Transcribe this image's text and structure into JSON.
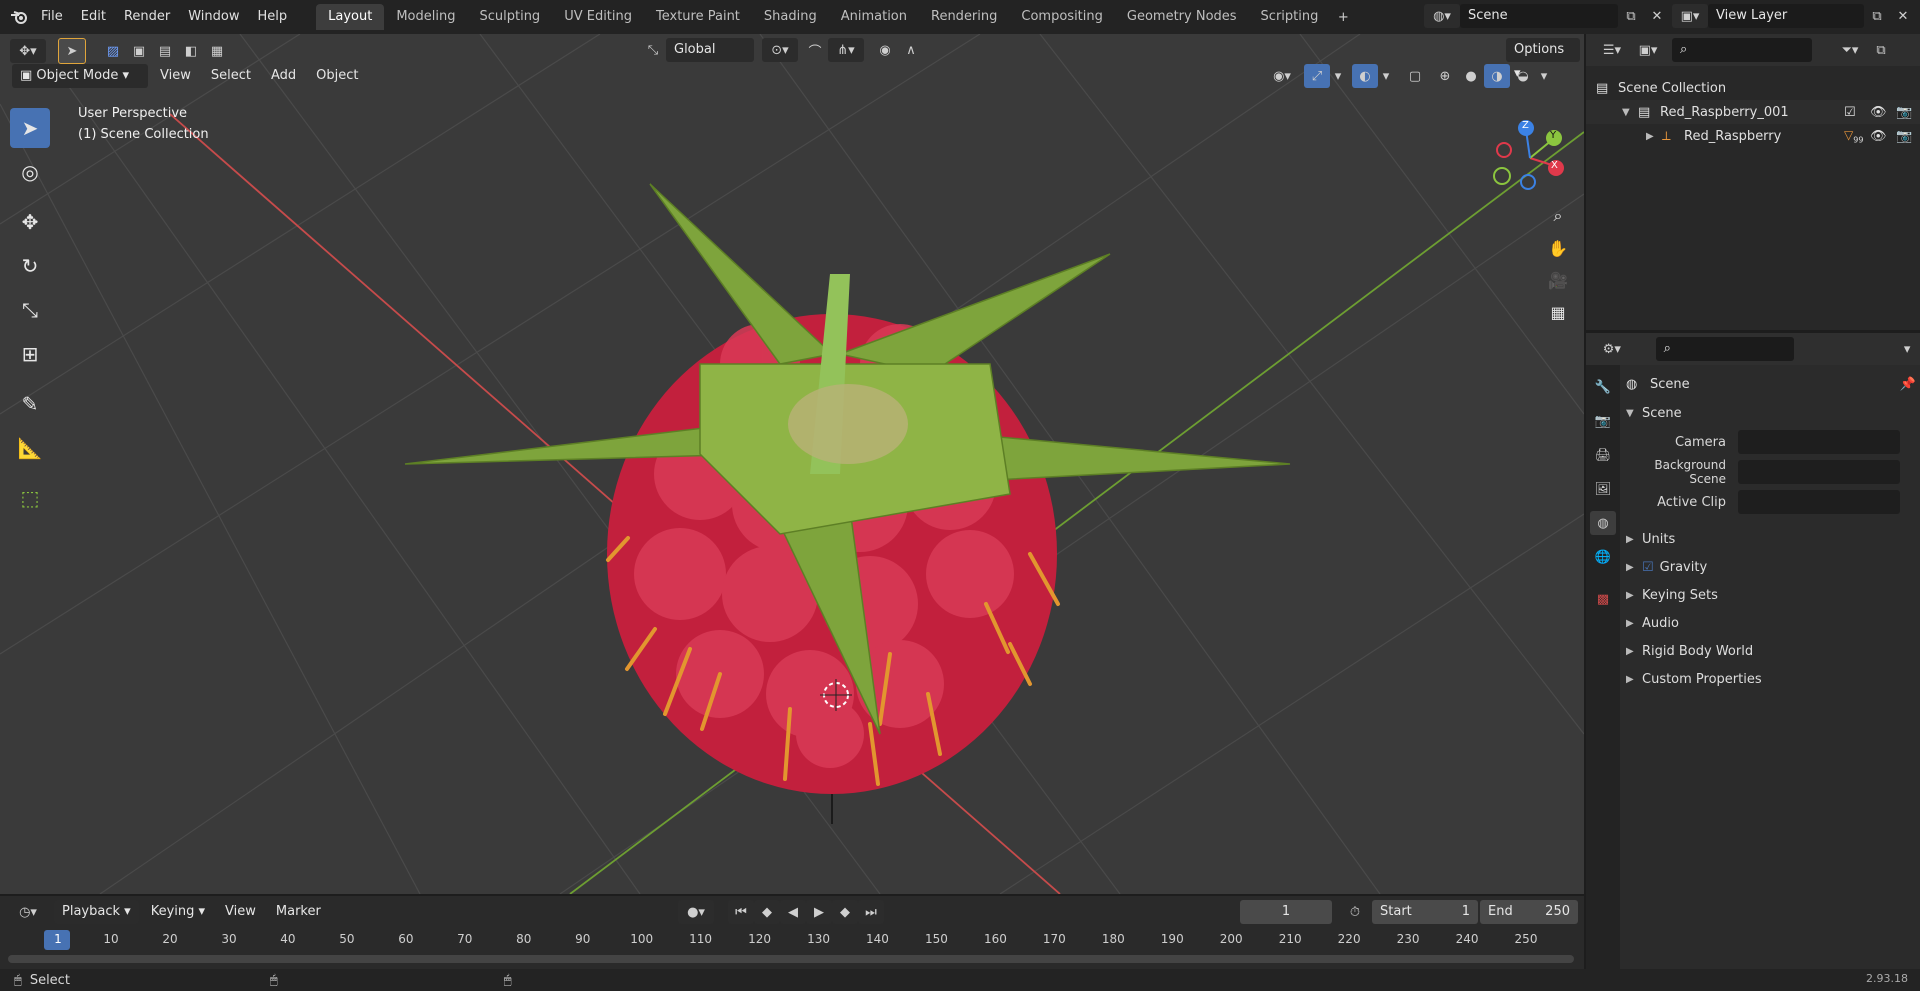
{
  "menu": {
    "file": "File",
    "edit": "Edit",
    "render": "Render",
    "window": "Window",
    "help": "Help"
  },
  "workspaces": [
    "Layout",
    "Modeling",
    "Sculpting",
    "UV Editing",
    "Texture Paint",
    "Shading",
    "Animation",
    "Rendering",
    "Compositing",
    "Geometry Nodes",
    "Scripting"
  ],
  "top_right": {
    "scene": "Scene",
    "view_layer": "View Layer"
  },
  "viewport": {
    "transform_orientation": "Global",
    "options": "Options",
    "mode": "Object Mode",
    "menus": [
      "View",
      "Select",
      "Add",
      "Object"
    ],
    "overlay_line1": "User Perspective",
    "overlay_line2": "(1) Scene Collection",
    "gizmo": {
      "x": "X",
      "y": "Y",
      "z": "Z"
    }
  },
  "outliner": {
    "root": "Scene Collection",
    "collection": "Red_Raspberry_001",
    "object": "Red_Raspberry",
    "badge": "99"
  },
  "properties": {
    "header": "Scene",
    "panel": "Scene",
    "camera_label": "Camera",
    "bg_scene_label": "Background Scene",
    "active_clip_label": "Active Clip",
    "sections": [
      "Units",
      "Gravity",
      "Keying Sets",
      "Audio",
      "Rigid Body World",
      "Custom Properties"
    ]
  },
  "timeline": {
    "menus": [
      "Playback",
      "Keying",
      "View",
      "Marker"
    ],
    "current_frame": "1",
    "start_label": "Start",
    "start": "1",
    "end_label": "End",
    "end": "250",
    "ticks": [
      "1",
      "10",
      "20",
      "30",
      "40",
      "50",
      "60",
      "70",
      "80",
      "90",
      "100",
      "110",
      "120",
      "130",
      "140",
      "150",
      "160",
      "170",
      "180",
      "190",
      "200",
      "210",
      "220",
      "230",
      "240",
      "250"
    ]
  },
  "status": {
    "select": "Select",
    "version": "2.93.18"
  },
  "colors": {
    "accent": "#4772b3",
    "axis_x": "#e0394b",
    "axis_y": "#8bc53f",
    "axis_z": "#3b82e5"
  }
}
